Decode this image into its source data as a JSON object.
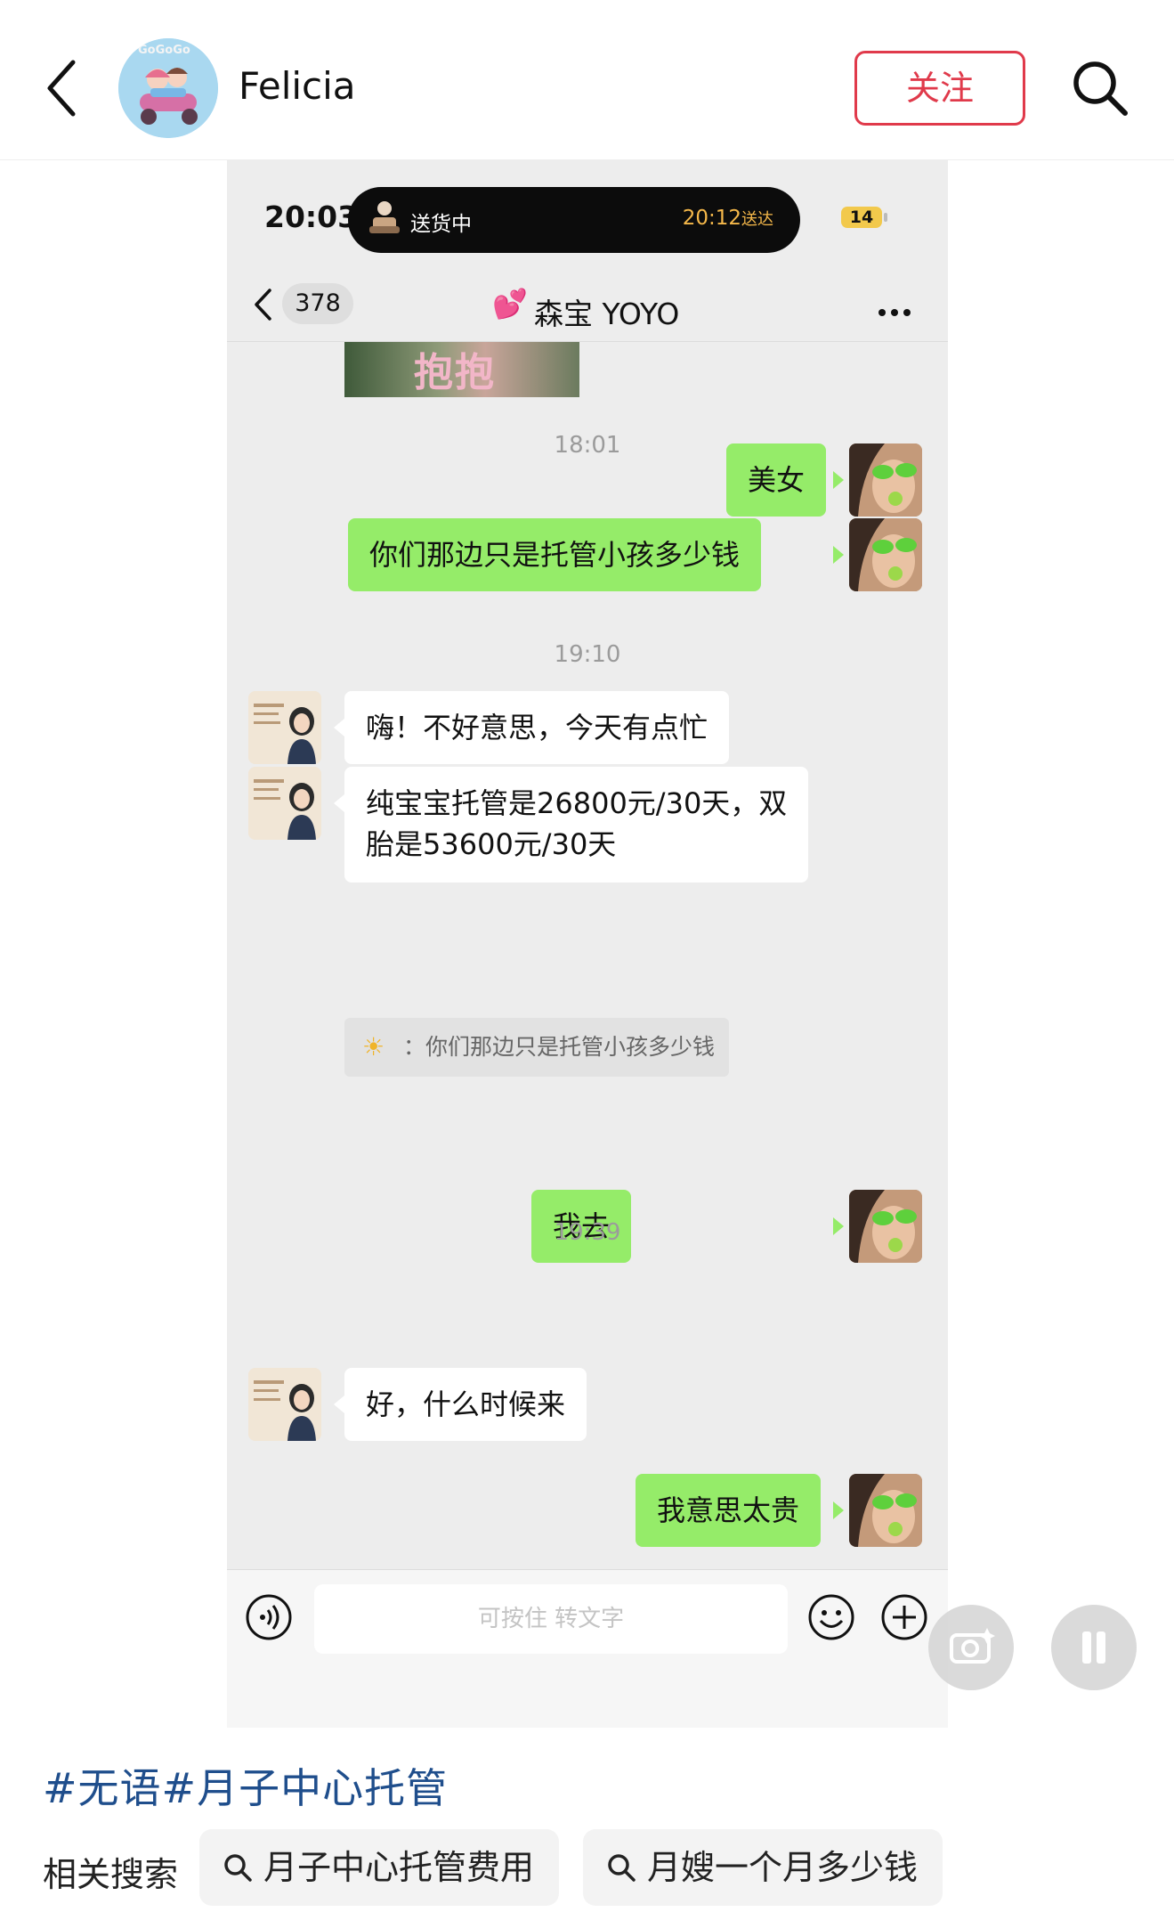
{
  "header": {
    "author_name": "Felicia",
    "avatar_text": "GoGoGo",
    "follow_label": "关注"
  },
  "screenshot": {
    "status_time": "20:03",
    "island": {
      "status": "送货中",
      "eta_time": "20:12",
      "eta_suffix": "送达"
    },
    "battery": "14",
    "chat": {
      "unread_count": "378",
      "title_emoji": "💕",
      "title": "森宝 YOYO",
      "sticker_text": "抱抱",
      "messages": [
        {
          "type": "time",
          "text": "18:01"
        },
        {
          "type": "out",
          "text": "美女"
        },
        {
          "type": "out",
          "text": "你们那边只是托管小孩多少钱"
        },
        {
          "type": "time",
          "text": "19:10"
        },
        {
          "type": "in",
          "text": "嗨！不好意思，今天有点忙"
        },
        {
          "type": "in",
          "line1": "纯宝宝托管是26800元/30天，双",
          "line2": "胎是53600元/30天"
        },
        {
          "type": "quote",
          "text": "：你们那边只是托管小孩多少钱"
        },
        {
          "type": "out",
          "text": "我去"
        },
        {
          "type": "time",
          "text": "19:39"
        },
        {
          "type": "in",
          "text": "好，什么时候来"
        },
        {
          "type": "out",
          "text": "我意思太贵"
        }
      ],
      "input_placeholder": "可按住 转文字"
    }
  },
  "caption": {
    "hashtags": "#无语#月子中心托管"
  },
  "related": {
    "label": "相关搜索",
    "items": [
      "月子中心托管费用",
      "月嫂一个月多少钱"
    ]
  },
  "colors": {
    "follow": "#e03a4b",
    "hashtag": "#1f4e8c",
    "bubble_out": "#95ec69",
    "bubble_in": "#ffffff",
    "chat_bg": "#ededed"
  }
}
